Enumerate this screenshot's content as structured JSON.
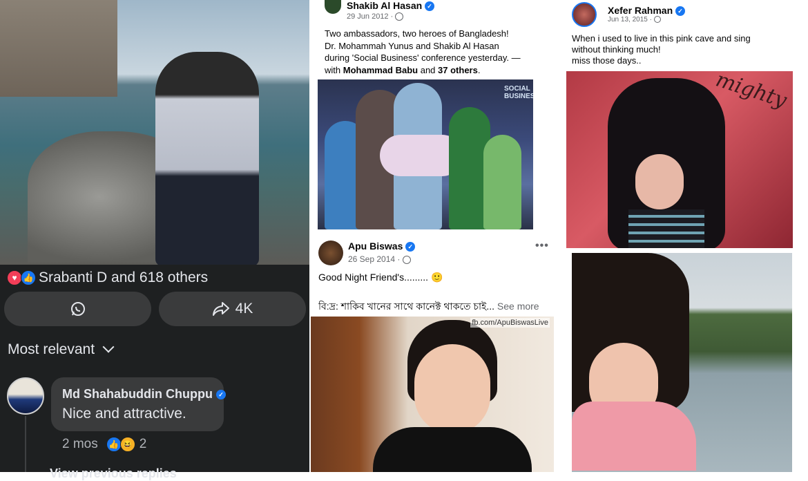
{
  "left_post": {
    "reactions_text": "Srabanti D and 618 others",
    "share_count": "4K",
    "sort_label": "Most relevant",
    "comment": {
      "author": "Md Shahabuddin Chuppu",
      "text": "Nice and attractive.",
      "time": "2 mos",
      "reaction_count": "2"
    },
    "view_more_label": "View previous replies"
  },
  "middle_post_1": {
    "author": "Shakib Al Hasan",
    "date": "29 Jun 2012",
    "text_line1": "Two ambassadors, two heroes of Bangladesh!",
    "text_line2": "Dr. Mohammah Yunus and Shakib Al Hasan",
    "text_line3": "during 'Social Business' conference yesterday. —",
    "text_with": "with",
    "tag1": "Mohammad Babu",
    "text_and": "and",
    "tag2": "37 others",
    "text_end": ".",
    "photo_sign": "SOCIAL BUSINESS"
  },
  "middle_post_2": {
    "author": "Apu Biswas",
    "date": "26 Sep 2014",
    "text_line1": "Good Night Friend's......... 🙂",
    "text_line2": "বি:দ্র: শাকিব খানের সাথে কানেক্ট থাকতে চাই...",
    "see_more": "See more",
    "watermark": "fb.com/ApuBiswasLive"
  },
  "right_post": {
    "author": "Xefer Rahman",
    "date": "Jun 13, 2015",
    "text_line1": "When i used to live in this pink cave and sing",
    "text_line2": "without thinking much!",
    "text_line3": "miss those days..",
    "wall_text": "mighty"
  },
  "colors": {
    "fb_blue": "#1877f2",
    "dark_bg": "#1e2021",
    "dark_pill": "#3a3b3c",
    "love_red": "#f33e58"
  }
}
